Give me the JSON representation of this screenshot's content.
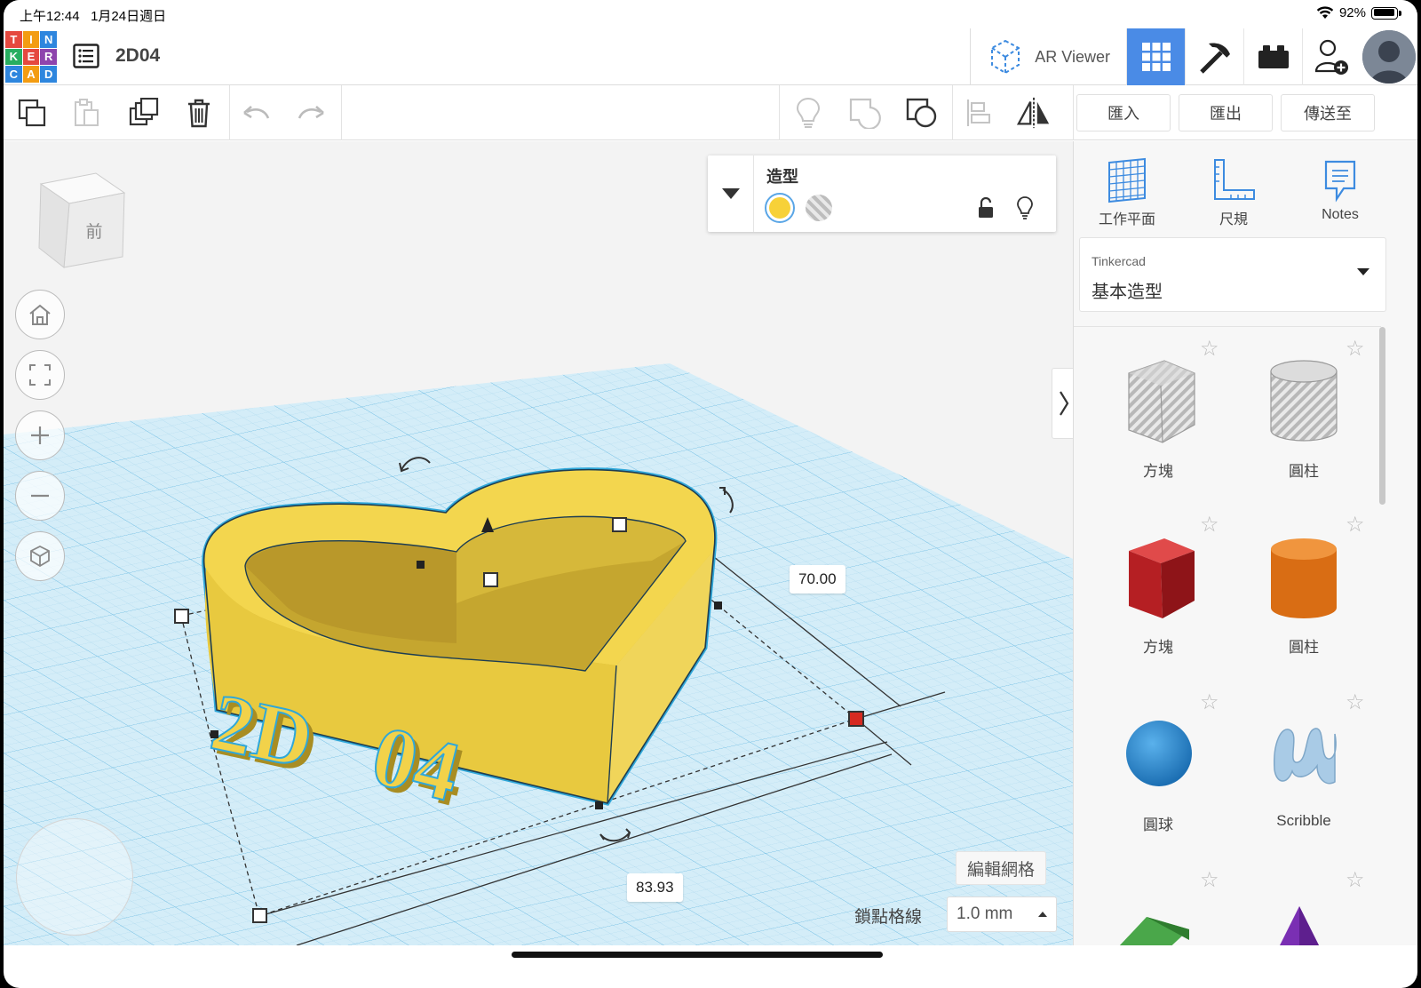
{
  "status_bar": {
    "time": "上午12:44",
    "date": "1月24日週日",
    "battery": "92%"
  },
  "header": {
    "logo_letters": [
      "T",
      "I",
      "N",
      "K",
      "E",
      "R",
      "C",
      "A",
      "D"
    ],
    "design_title": "2D04",
    "ar_viewer_label": "AR Viewer"
  },
  "toolbar": {
    "import_label": "匯入",
    "export_label": "匯出",
    "send_to_label": "傳送至"
  },
  "viewcube": {
    "face_label": "前"
  },
  "inspector": {
    "title": "造型",
    "solid_color": "#f7d138",
    "selected": "solid"
  },
  "dimensions": {
    "width": "70.00",
    "length": "83.93"
  },
  "viewport": {
    "edit_grid_label": "編輯網格",
    "snap_grid_label": "鎖點格線",
    "snap_grid_value": "1.0 mm"
  },
  "right_panel": {
    "tools": [
      {
        "label": "工作平面",
        "icon": "workplane-icon"
      },
      {
        "label": "尺規",
        "icon": "ruler-icon"
      },
      {
        "label": "Notes",
        "icon": "notes-icon"
      }
    ],
    "library": {
      "source": "Tinkercad",
      "category": "基本造型"
    },
    "shapes": [
      {
        "name": "方塊",
        "kind": "box-hole"
      },
      {
        "name": "圓柱",
        "kind": "cylinder-hole"
      },
      {
        "name": "方塊",
        "kind": "box",
        "color": "#c8262a"
      },
      {
        "name": "圓柱",
        "kind": "cylinder",
        "color": "#e27a1e"
      },
      {
        "name": "圓球",
        "kind": "sphere",
        "color": "#2b8fd6"
      },
      {
        "name": "Scribble",
        "kind": "scribble",
        "color": "#a9cbe6"
      }
    ]
  },
  "colors": {
    "accent": "#4a8be6",
    "heart_fill": "#f2d24a",
    "outline": "#2fa7d9"
  }
}
